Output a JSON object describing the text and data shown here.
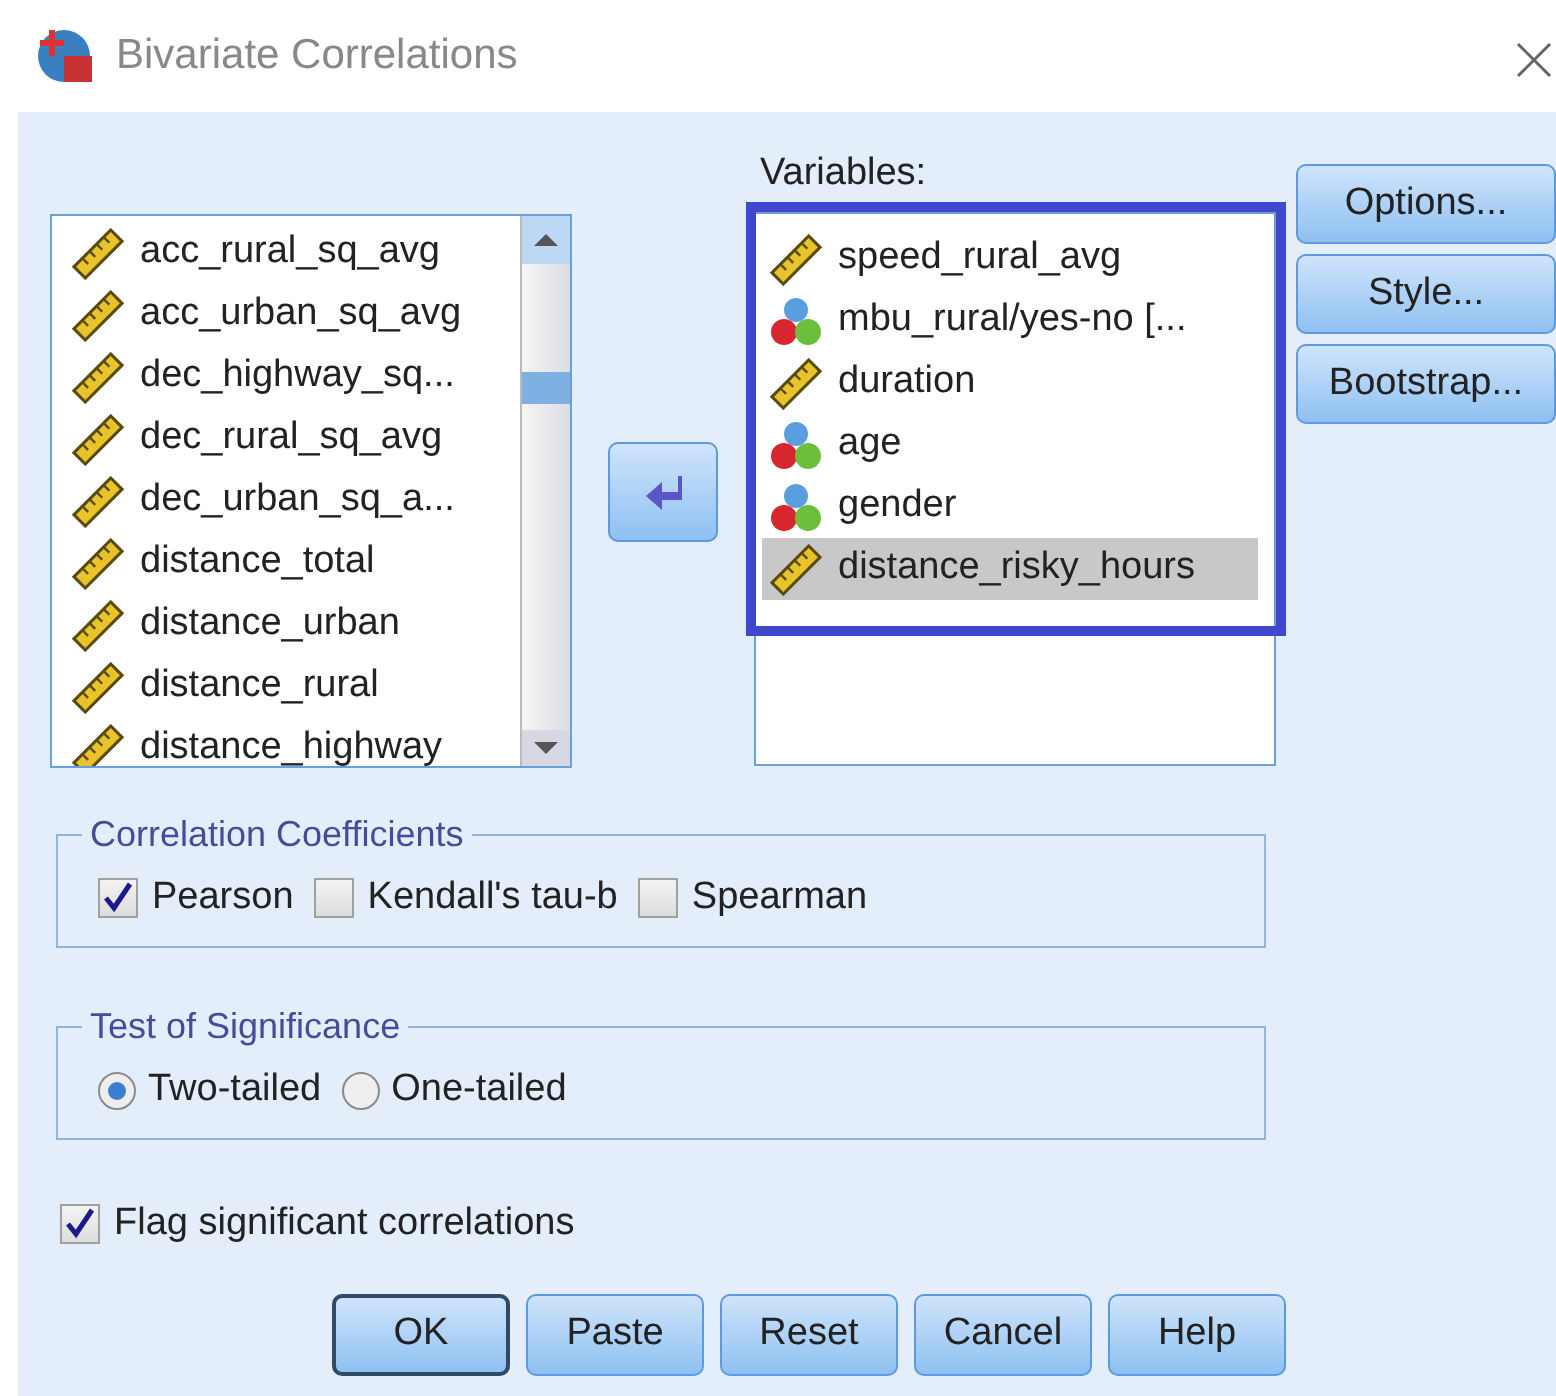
{
  "window": {
    "title": "Bivariate Correlations"
  },
  "source_list": {
    "items": [
      {
        "name": "acc_rural_sq_avg",
        "kind": "scale",
        "selected": false
      },
      {
        "name": "acc_urban_sq_avg",
        "kind": "scale",
        "selected": false
      },
      {
        "name": "dec_highway_sq...",
        "kind": "scale",
        "selected": false
      },
      {
        "name": "dec_rural_sq_avg",
        "kind": "scale",
        "selected": false
      },
      {
        "name": "dec_urban_sq_a...",
        "kind": "scale",
        "selected": false
      },
      {
        "name": "distance_total",
        "kind": "scale",
        "selected": false
      },
      {
        "name": "distance_urban",
        "kind": "scale",
        "selected": false
      },
      {
        "name": "distance_rural",
        "kind": "scale",
        "selected": false
      },
      {
        "name": "distance_highway",
        "kind": "scale",
        "selected": false
      }
    ]
  },
  "variables": {
    "label": "Variables:",
    "items": [
      {
        "name": "speed_rural_avg",
        "kind": "scale",
        "selected": false
      },
      {
        "name": "mbu_rural/yes-no [...",
        "kind": "nominal",
        "selected": false
      },
      {
        "name": "duration",
        "kind": "scale",
        "selected": false
      },
      {
        "name": "age",
        "kind": "nominal",
        "selected": false
      },
      {
        "name": "gender",
        "kind": "nominal",
        "selected": false
      },
      {
        "name": "distance_risky_hours",
        "kind": "scale",
        "selected": true
      }
    ]
  },
  "side_buttons": [
    "Options...",
    "Style...",
    "Bootstrap..."
  ],
  "correlation_coefficients": {
    "title": "Correlation Coefficients",
    "options": [
      {
        "label": "Pearson",
        "checked": true
      },
      {
        "label": "Kendall's tau-b",
        "checked": false
      },
      {
        "label": "Spearman",
        "checked": false
      }
    ]
  },
  "test_of_significance": {
    "title": "Test of Significance",
    "options": [
      {
        "label": "Two-tailed",
        "selected": true
      },
      {
        "label": "One-tailed",
        "selected": false
      }
    ]
  },
  "flag_significant": {
    "label": "Flag significant correlations",
    "checked": true
  },
  "buttons": [
    {
      "label": "OK",
      "default": true
    },
    {
      "label": "Paste",
      "default": false
    },
    {
      "label": "Reset",
      "default": false
    },
    {
      "label": "Cancel",
      "default": false
    },
    {
      "label": "Help",
      "default": false
    }
  ]
}
